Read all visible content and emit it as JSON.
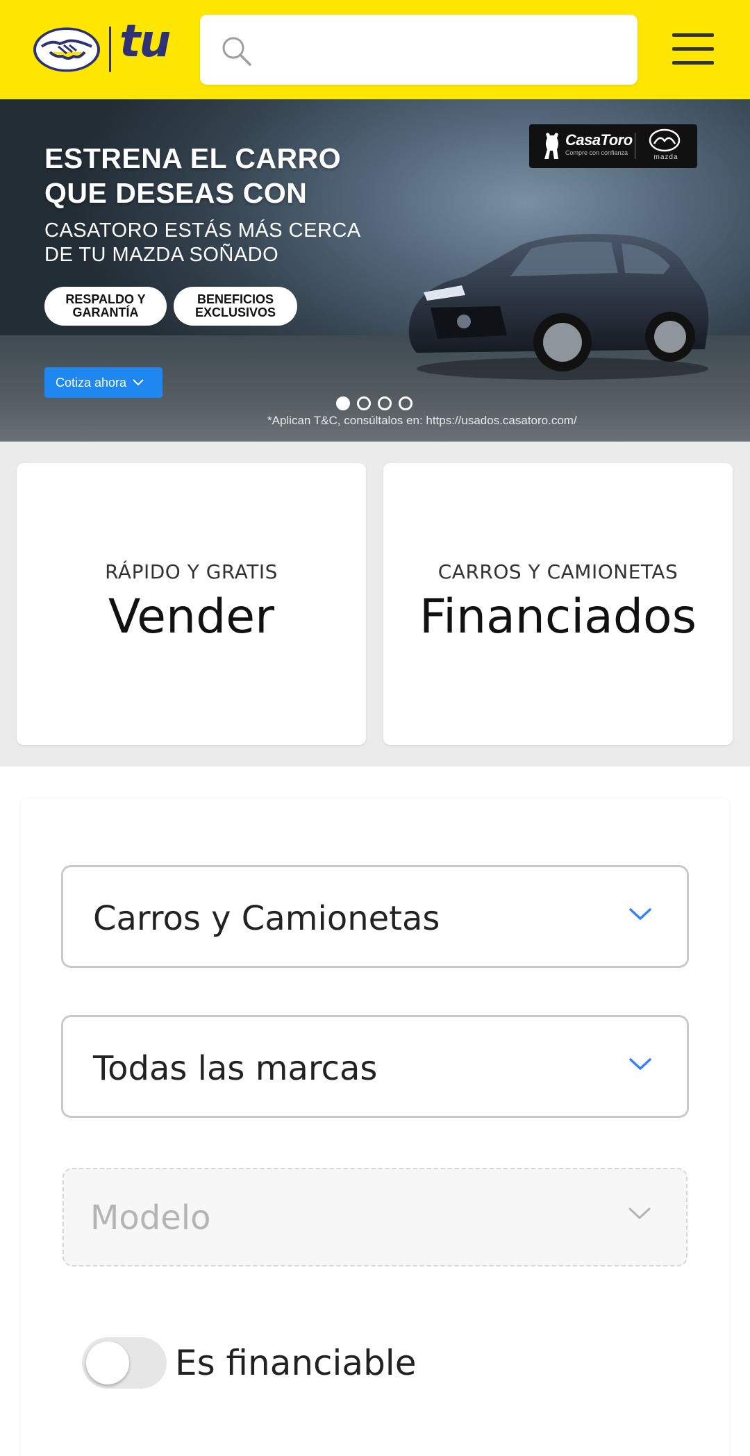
{
  "colors": {
    "header_bg": "#ffe600",
    "accent": "#3483fa",
    "cta_bg": "#1e88f0",
    "page_bg": "#ebebeb"
  },
  "header": {
    "logo_icon": "handshake-logo-icon",
    "logo_text": "tu",
    "search": {
      "icon": "search-icon",
      "placeholder": ""
    },
    "menu_icon": "hamburger-menu-icon"
  },
  "banner": {
    "headline_line1": "ESTRENA EL CARRO",
    "headline_line2": "QUE DESEAS CON",
    "sub_line1": "CASATORO ESTÁS MÁS CERCA",
    "sub_line2": "DE TU MAZDA SOÑADO",
    "pill1_line1": "RESPALDO Y",
    "pill1_line2": "GARANTÍA",
    "pill2_line1": "BENEFICIOS",
    "pill2_line2": "EXCLUSIVOS",
    "cta_label": "Cotiza ahora",
    "brand_name": "CasaToro",
    "brand_tagline": "Compre con confianza",
    "brand_partner": "mazda",
    "disclaimer": "*Aplican T&C, consúltalos en: https://usados.casatoro.com/",
    "slides_total": 4,
    "active_slide": 1
  },
  "cards": [
    {
      "kicker": "RÁPIDO Y GRATIS",
      "title": "Vender"
    },
    {
      "kicker": "CARROS Y CAMIONETAS",
      "title": "Financiados"
    }
  ],
  "filters": {
    "category": "Carros y Camionetas",
    "brand": "Todas las marcas",
    "model_placeholder": "Modelo",
    "financeable_label": "Es financiable",
    "financeable_on": false
  }
}
